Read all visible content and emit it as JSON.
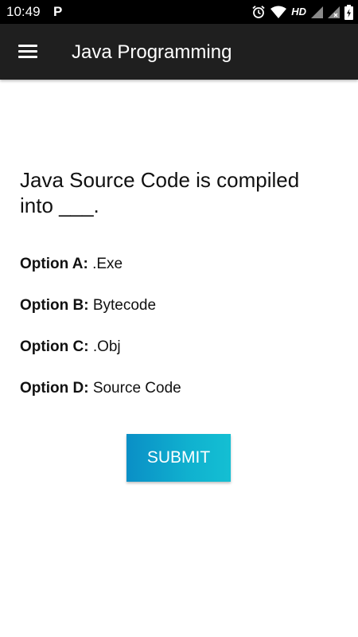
{
  "status_bar": {
    "time": "10:49",
    "notification_letter": "P",
    "network_label": "HD",
    "icons": [
      "alarm-icon",
      "wifi-icon",
      "signal-icon",
      "signal-x-icon",
      "battery-charging-icon"
    ]
  },
  "app_bar": {
    "title": "Java Programming",
    "menu_icon": "hamburger-menu-icon",
    "background_color": "#1f1f1f"
  },
  "quiz": {
    "question": "Java Source Code is compiled into ___.",
    "options": [
      {
        "key": "Option A:",
        "text": ".Exe"
      },
      {
        "key": "Option B:",
        "text": "Bytecode"
      },
      {
        "key": "Option C:",
        "text": ".Obj"
      },
      {
        "key": "Option D:",
        "text": "Source Code"
      }
    ],
    "submit_label": "SUBMIT",
    "submit_color": "#10b1cf"
  }
}
